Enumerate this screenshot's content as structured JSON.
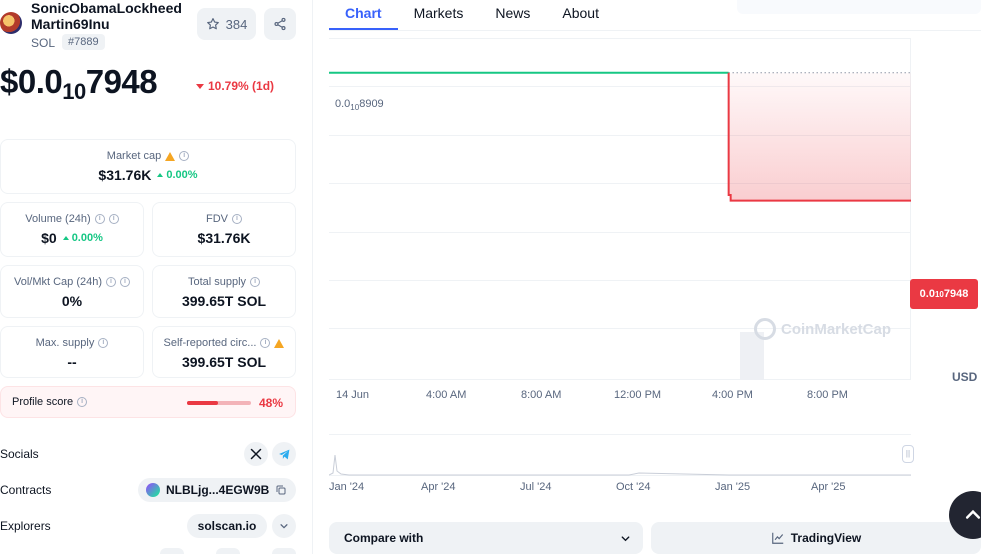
{
  "coin": {
    "name": "SonicObamaLockheed Martin69Inu",
    "symbol": "SOL",
    "rank": "#7889",
    "watchlist_count": "384",
    "price_prefix": "$0.0",
    "price_zeros": "10",
    "price_digits": "7948",
    "change": "10.79% (1d)"
  },
  "stats": {
    "market_cap": {
      "label": "Market cap",
      "value": "$31.76K",
      "change": "0.00%"
    },
    "volume": {
      "label": "Volume (24h)",
      "value": "$0",
      "change": "0.00%"
    },
    "fdv": {
      "label": "FDV",
      "value": "$31.76K"
    },
    "vol_mkt_cap": {
      "label": "Vol/Mkt Cap (24h)",
      "value": "0%"
    },
    "total_supply": {
      "label": "Total supply",
      "value": "399.65T SOL"
    },
    "max_supply": {
      "label": "Max. supply",
      "value": "--"
    },
    "self_reported": {
      "label": "Self-reported circ...",
      "value": "399.65T SOL"
    }
  },
  "profile": {
    "label": "Profile score",
    "value": "48%",
    "score": 0.48
  },
  "links": {
    "socials_label": "Socials",
    "contracts_label": "Contracts",
    "contract_address": "NLBLjg...4EGW9B",
    "explorers_label": "Explorers",
    "explorer": "solscan.io"
  },
  "tabs": [
    "Chart",
    "Markets",
    "News",
    "About"
  ],
  "chart": {
    "high_label_prefix": "0.0",
    "high_label_zeros": "10",
    "high_label_digits": "8909",
    "current_label_prefix": "0.0",
    "current_label_zeros": "10",
    "current_label_digits": "7948",
    "watermark": "CoinMarketCap",
    "currency": "USD",
    "x_ticks": [
      "14 Jun",
      "4:00 AM",
      "8:00 AM",
      "12:00 PM",
      "4:00 PM",
      "8:00 PM"
    ],
    "nav_ticks": [
      "Jan '24",
      "Apr '24",
      "Jul '24",
      "Oct '24",
      "Jan '25",
      "Apr '25"
    ],
    "colors": {
      "up": "#16c784",
      "down": "#ea3943",
      "accent": "#3861fb"
    }
  },
  "chart_data": {
    "type": "line",
    "title": "",
    "xlabel": "",
    "ylabel": "USD",
    "x": [
      "14 Jun 00:00",
      "4:00 AM",
      "8:00 AM",
      "12:00 PM",
      "4:00 PM",
      "4:05 PM",
      "5:50 PM",
      "9:30 PM"
    ],
    "series": [
      {
        "values": [
          8.909,
          8.909,
          8.909,
          8.909,
          8.909,
          7.99,
          7.948,
          7.948
        ]
      }
    ],
    "y_unit_note": "",
    "grid": true,
    "legend": "none"
  },
  "buttons": {
    "compare": "Compare with",
    "tradingview": "TradingView"
  },
  "icons": [
    "star-icon",
    "share-icon",
    "info-icon",
    "warning-icon",
    "x-twitter-icon",
    "telegram-icon",
    "copy-icon",
    "chevron-down-icon",
    "chevron-up-icon",
    "chart-line-icon"
  ]
}
